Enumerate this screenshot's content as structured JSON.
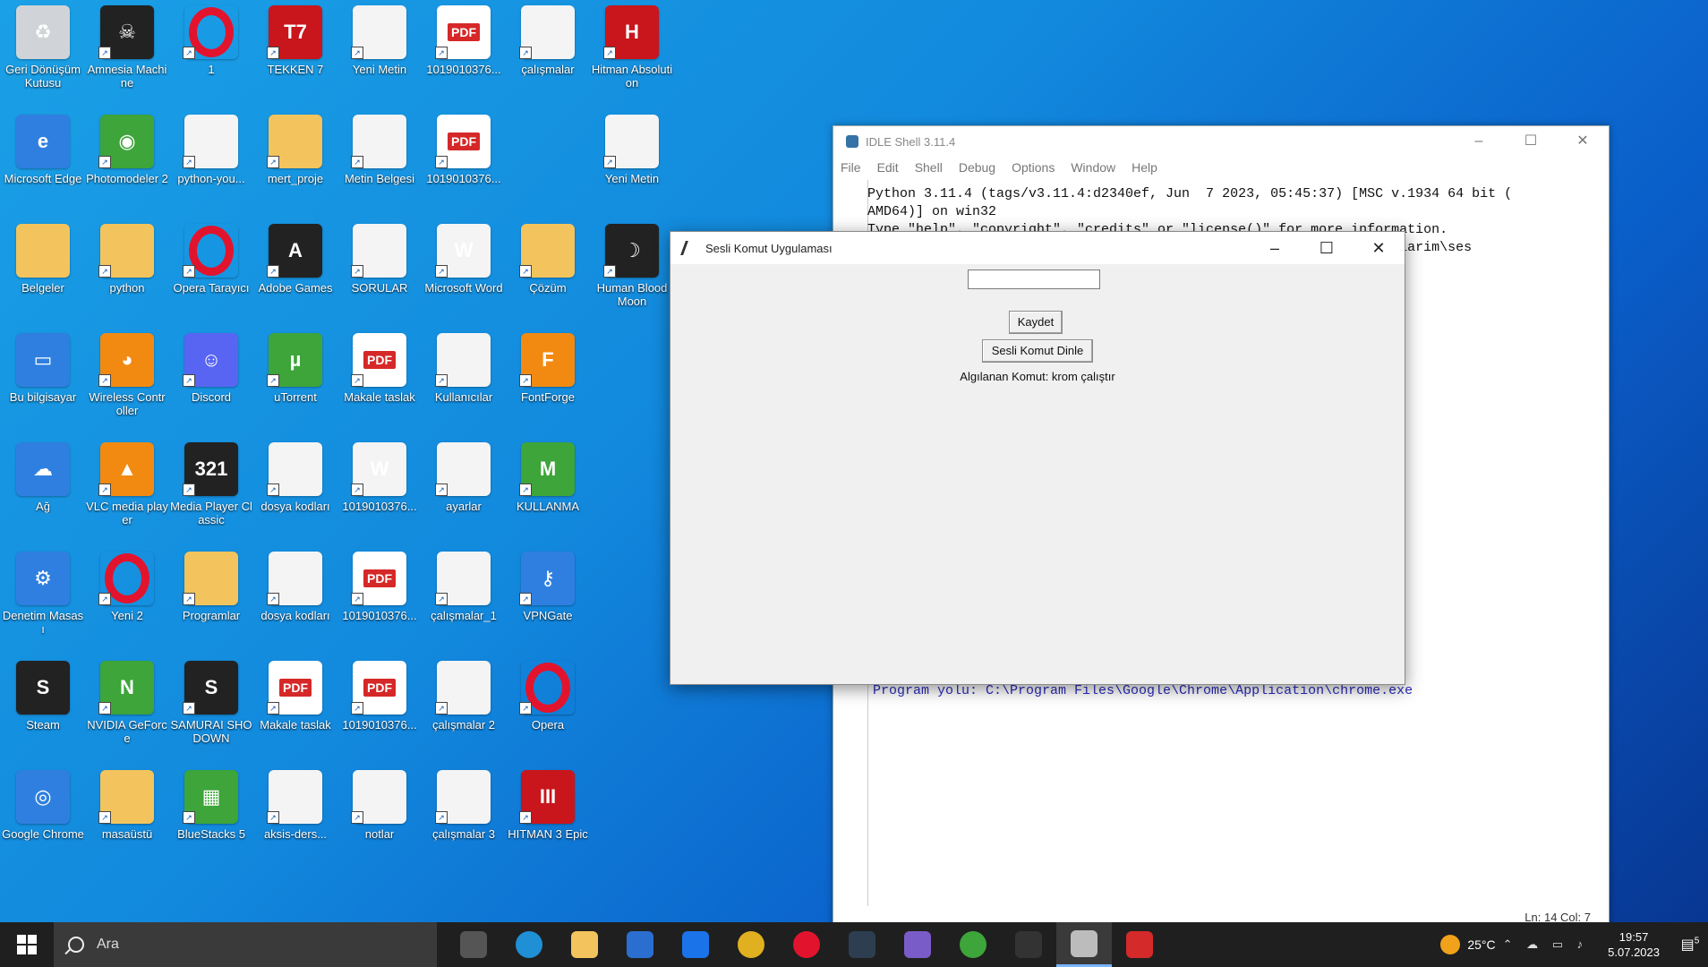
{
  "desktop": {
    "icons": [
      {
        "label": "Geri Dönüşüm Kutusu",
        "glyph": "♻",
        "type": "gray",
        "col": 0,
        "row": 0
      },
      {
        "label": "Amnesia Machine",
        "glyph": "☠",
        "type": "dark",
        "col": 1,
        "row": 0
      },
      {
        "label": "1",
        "glyph": "",
        "type": "opera",
        "col": 2,
        "row": 0
      },
      {
        "label": "TEKKEN 7",
        "glyph": "T7",
        "type": "red",
        "col": 3,
        "row": 0
      },
      {
        "label": "Yeni Metin",
        "glyph": "",
        "type": "file",
        "col": 4,
        "row": 0
      },
      {
        "label": "1019010376...",
        "glyph": "PDF",
        "type": "pdf",
        "col": 5,
        "row": 0
      },
      {
        "label": "çalışmalar",
        "glyph": "",
        "type": "file",
        "col": 6,
        "row": 0
      },
      {
        "label": "Hitman Absolution",
        "glyph": "H",
        "type": "red",
        "col": 7,
        "row": 0
      },
      {
        "label": "Microsoft Edge",
        "glyph": "e",
        "type": "blue",
        "col": 0,
        "row": 1
      },
      {
        "label": "Photomodeler 2",
        "glyph": "◉",
        "type": "green",
        "col": 1,
        "row": 1
      },
      {
        "label": "python-you...",
        "glyph": "",
        "type": "file",
        "col": 2,
        "row": 1
      },
      {
        "label": "mert_proje",
        "glyph": "",
        "type": "folder",
        "col": 3,
        "row": 1
      },
      {
        "label": "Metin Belgesi",
        "glyph": "",
        "type": "file",
        "col": 4,
        "row": 1
      },
      {
        "label": "1019010376...",
        "glyph": "PDF",
        "type": "pdf",
        "col": 5,
        "row": 1
      },
      {
        "label": "Yeni Metin",
        "glyph": "",
        "type": "file",
        "col": 7,
        "row": 1
      },
      {
        "label": "Belgeler",
        "glyph": "",
        "type": "folder",
        "col": 0,
        "row": 2
      },
      {
        "label": "python",
        "glyph": "",
        "type": "folder",
        "col": 1,
        "row": 2
      },
      {
        "label": "Opera Tarayıcı",
        "glyph": "",
        "type": "opera",
        "col": 2,
        "row": 2
      },
      {
        "label": "Adobe Games",
        "glyph": "A",
        "type": "dark",
        "col": 3,
        "row": 2
      },
      {
        "label": "SORULAR",
        "glyph": "",
        "type": "file",
        "col": 4,
        "row": 2
      },
      {
        "label": "Microsoft Word",
        "glyph": "W",
        "type": "file",
        "col": 5,
        "row": 2
      },
      {
        "label": "Çözüm",
        "glyph": "",
        "type": "folder",
        "col": 6,
        "row": 2
      },
      {
        "label": "Human Blood Moon",
        "glyph": "☽",
        "type": "dark",
        "col": 7,
        "row": 2
      },
      {
        "label": "Bu bilgisayar",
        "glyph": "▭",
        "type": "blue",
        "col": 0,
        "row": 3
      },
      {
        "label": "Wireless Controller",
        "glyph": "◕",
        "type": "orange",
        "col": 1,
        "row": 3
      },
      {
        "label": "Discord",
        "glyph": "☺",
        "type": "purple",
        "col": 2,
        "row": 3
      },
      {
        "label": "uTorrent",
        "glyph": "µ",
        "type": "green",
        "col": 3,
        "row": 3
      },
      {
        "label": "Makale taslak",
        "glyph": "PDF",
        "type": "pdf",
        "col": 4,
        "row": 3
      },
      {
        "label": "Kullanıcılar",
        "glyph": "",
        "type": "file",
        "col": 5,
        "row": 3
      },
      {
        "label": "FontForge",
        "glyph": "F",
        "type": "orange",
        "col": 6,
        "row": 3
      },
      {
        "label": "Ağ",
        "glyph": "☁",
        "type": "blue",
        "col": 0,
        "row": 4
      },
      {
        "label": "VLC media player",
        "glyph": "▲",
        "type": "orange",
        "col": 1,
        "row": 4
      },
      {
        "label": "Media Player Classic",
        "glyph": "321",
        "type": "dark",
        "col": 2,
        "row": 4
      },
      {
        "label": "dosya kodları",
        "glyph": "",
        "type": "file",
        "col": 3,
        "row": 4
      },
      {
        "label": "1019010376...",
        "glyph": "W",
        "type": "file",
        "col": 4,
        "row": 4
      },
      {
        "label": "ayarlar",
        "glyph": "",
        "type": "file",
        "col": 5,
        "row": 4
      },
      {
        "label": "KULLANMA",
        "glyph": "M",
        "type": "green",
        "col": 6,
        "row": 4
      },
      {
        "label": "Denetim Masası",
        "glyph": "⚙",
        "type": "blue",
        "col": 0,
        "row": 5
      },
      {
        "label": "Yeni 2",
        "glyph": "",
        "type": "opera",
        "col": 1,
        "row": 5
      },
      {
        "label": "Programlar",
        "glyph": "",
        "type": "folder",
        "col": 2,
        "row": 5
      },
      {
        "label": "dosya kodları",
        "glyph": "",
        "type": "file",
        "col": 3,
        "row": 5
      },
      {
        "label": "1019010376...",
        "glyph": "PDF",
        "type": "pdf",
        "col": 4,
        "row": 5
      },
      {
        "label": "çalışmalar_1",
        "glyph": "",
        "type": "file",
        "col": 5,
        "row": 5
      },
      {
        "label": "VPNGate",
        "glyph": "⚷",
        "type": "blue",
        "col": 6,
        "row": 5
      },
      {
        "label": "Steam",
        "glyph": "S",
        "type": "dark",
        "col": 0,
        "row": 6
      },
      {
        "label": "NVIDIA GeForce",
        "glyph": "N",
        "type": "green",
        "col": 1,
        "row": 6
      },
      {
        "label": "SAMURAI SHODOWN",
        "glyph": "S",
        "type": "dark",
        "col": 2,
        "row": 6
      },
      {
        "label": "Makale taslak",
        "glyph": "PDF",
        "type": "pdf",
        "col": 3,
        "row": 6
      },
      {
        "label": "1019010376...",
        "glyph": "PDF",
        "type": "pdf",
        "col": 4,
        "row": 6
      },
      {
        "label": "çalışmalar 2",
        "glyph": "",
        "type": "file",
        "col": 5,
        "row": 6
      },
      {
        "label": "Opera",
        "glyph": "",
        "type": "opera",
        "col": 6,
        "row": 6
      },
      {
        "label": "Google Chrome",
        "glyph": "◎",
        "type": "blue",
        "col": 0,
        "row": 7
      },
      {
        "label": "masaüstü",
        "glyph": "",
        "type": "folder",
        "col": 1,
        "row": 7
      },
      {
        "label": "BlueStacks 5",
        "glyph": "▦",
        "type": "green",
        "col": 2,
        "row": 7
      },
      {
        "label": "aksis-ders...",
        "glyph": "",
        "type": "file",
        "col": 3,
        "row": 7
      },
      {
        "label": "notlar",
        "glyph": "",
        "type": "file",
        "col": 4,
        "row": 7
      },
      {
        "label": "çalışmalar 3",
        "glyph": "",
        "type": "file",
        "col": 5,
        "row": 7
      },
      {
        "label": "HITMAN 3 Epic",
        "glyph": "III",
        "type": "red",
        "col": 6,
        "row": 7
      }
    ]
  },
  "idle": {
    "title": "IDLE Shell 3.11.4",
    "menu": [
      "File",
      "Edit",
      "Shell",
      "Debug",
      "Options",
      "Window",
      "Help"
    ],
    "text": "Python 3.11.4 (tags/v3.11.4:d2340ef, Jun  7 2023, 05:45:37) [MSC v.1934 64 bit (\nAMD64)] on win32\nType \"help\", \"copyright\", \"credits\" or \"license()\" for more information.\n                                                       mut_calismalarim\\ses",
    "output": "Program yolu: C:\\Program Files\\Google\\Chrome\\Application\\chrome.exe",
    "status": "Ln: 14  Col: 7"
  },
  "app": {
    "title": "Sesli Komut Uygulaması",
    "entry_value": "",
    "save_label": "Kaydet",
    "listen_label": "Sesli Komut Dinle",
    "detected_text": "Algılanan Komut: krom çalıştır"
  },
  "window_controls": {
    "minimize": "–",
    "maximize": "☐",
    "close": "✕"
  },
  "taskbar": {
    "search_placeholder": "Ara",
    "apps": [
      {
        "name": "task-view",
        "color": "#555"
      },
      {
        "name": "edge",
        "color": "#1f8fd6"
      },
      {
        "name": "file-explorer",
        "color": "#f3c45d"
      },
      {
        "name": "store",
        "color": "#2a6fd0"
      },
      {
        "name": "mail",
        "color": "#1a73e8"
      },
      {
        "name": "chrome",
        "color": "#e0b020"
      },
      {
        "name": "opera",
        "color": "#e2142d"
      },
      {
        "name": "steam",
        "color": "#2c3e50"
      },
      {
        "name": "discord-alt",
        "color": "#7a5cc8"
      },
      {
        "name": "utorrent",
        "color": "#3da53a"
      },
      {
        "name": "terminal",
        "color": "#333"
      },
      {
        "name": "idle-editor",
        "color": "#bcbcbc"
      },
      {
        "name": "anydesk",
        "color": "#d42a2a"
      }
    ],
    "weather": "25°C",
    "time": "19:57",
    "date": "5.07.2023",
    "notification_count": "5"
  }
}
